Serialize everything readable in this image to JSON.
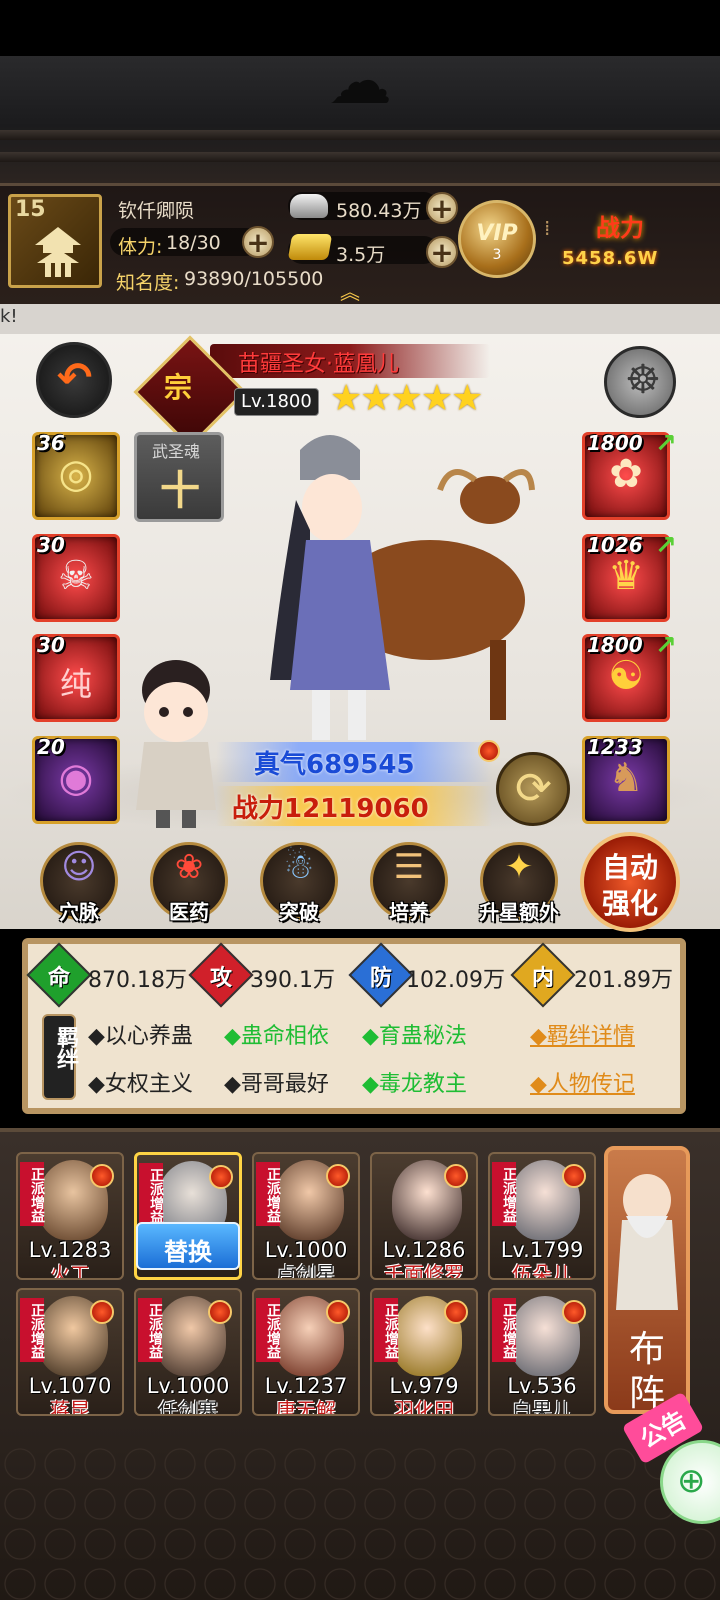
{
  "player": {
    "level": "15",
    "name": "钦仟卿陨",
    "stamina_label": "体力:",
    "stamina_value": "18/30",
    "fame_label": "知名度:",
    "fame_value": "93890/105500",
    "silver": "580.43万",
    "gold": "3.5万",
    "vip_text": "VIP",
    "vip_level": "3",
    "power_label": "战力",
    "power_value": "5458.6W"
  },
  "marquee": "k!",
  "hero": {
    "class_badge": "宗",
    "name": "苗疆圣女·蓝凰儿",
    "level": "Lv.1800",
    "stars": "★★★★★",
    "stars_count": 5,
    "zhenqi": "真气689545",
    "power": "战力12119060"
  },
  "left_slots": [
    {
      "count": "36",
      "glyph": "◎"
    },
    {
      "count": "30",
      "glyph": "☠"
    },
    {
      "count": "30",
      "glyph": "纯"
    },
    {
      "count": "20",
      "glyph": "◉"
    }
  ],
  "soul_slot": {
    "label": "武圣魂",
    "glyph": "十"
  },
  "right_slots": [
    {
      "count": "1800",
      "glyph": "✿"
    },
    {
      "count": "1026",
      "glyph": "♛"
    },
    {
      "count": "1800",
      "glyph": "☯"
    },
    {
      "count": "1233",
      "glyph": "♞"
    }
  ],
  "functions": [
    {
      "label": "穴脉",
      "icon": "meridian-icon",
      "glyph": "☺"
    },
    {
      "label": "医药",
      "icon": "medicine-icon",
      "glyph": "❀"
    },
    {
      "label": "突破",
      "icon": "breakthrough-icon",
      "glyph": "☃"
    },
    {
      "label": "培养",
      "icon": "cultivate-icon",
      "glyph": "☰"
    },
    {
      "label": "升星额外",
      "icon": "star-up-icon",
      "glyph": "✦"
    }
  ],
  "auto_button": {
    "line1": "自动",
    "line2": "强化"
  },
  "attributes": [
    {
      "icon": "命",
      "value": "870.18万",
      "color": "#1fa02c"
    },
    {
      "icon": "攻",
      "value": "390.1万",
      "color": "#d0202a"
    },
    {
      "icon": "防",
      "value": "102.09万",
      "color": "#2a6fd6"
    },
    {
      "icon": "内",
      "value": "201.89万",
      "color": "#d8a020"
    }
  ],
  "bonds_tag": "羁绊",
  "bonds": [
    {
      "text": "◆以心养蛊",
      "active": false
    },
    {
      "text": "◆蛊命相依",
      "active": true
    },
    {
      "text": "◆育蛊秘法",
      "active": true
    },
    {
      "text": "◆女权主义",
      "active": false
    },
    {
      "text": "◆哥哥最好",
      "active": false
    },
    {
      "text": "◆毒龙教主",
      "active": true
    }
  ],
  "links": {
    "bond_detail": "◆羁绊详情",
    "biography": "◆人物传记"
  },
  "team_tag": "正派增益",
  "team": [
    {
      "level": "Lv.1283",
      "name": "火工",
      "color": "#c41a1a"
    },
    {
      "level": "",
      "name": "",
      "color": "#222"
    },
    {
      "level": "Lv.1000",
      "name": "卢剑星",
      "color": "#222"
    },
    {
      "level": "Lv.1286",
      "name": "千面修罗",
      "color": "#c41a1a"
    },
    {
      "level": "Lv.1799",
      "name": "伍朵儿",
      "color": "#c41a1a"
    },
    {
      "level": "Lv.1070",
      "name": "蒋昆",
      "color": "#c41a1a"
    },
    {
      "level": "Lv.1000",
      "name": "任剑寒",
      "color": "#222"
    },
    {
      "level": "Lv.1237",
      "name": "唐无解",
      "color": "#c41a1a"
    },
    {
      "level": "Lv.979",
      "name": "羽化田",
      "color": "#c41a1a"
    },
    {
      "level": "Lv.536",
      "name": "白果儿",
      "color": "#222"
    }
  ],
  "replace_button": "替换",
  "formation_button": {
    "line1": "布",
    "line2": "阵"
  },
  "notice": "公告"
}
